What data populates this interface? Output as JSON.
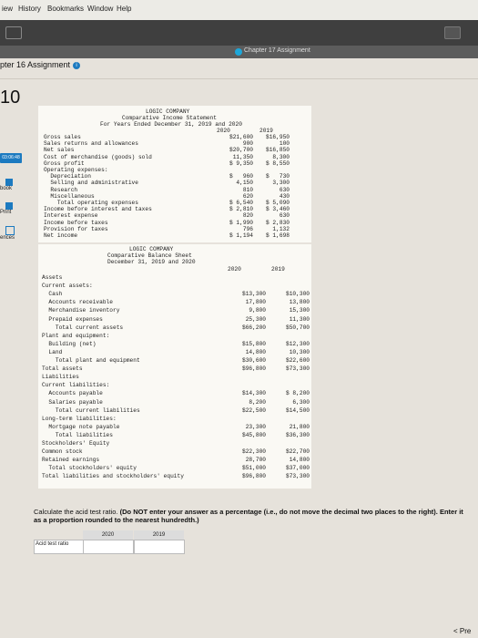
{
  "menu": [
    "iew",
    "History",
    "Bookmarks",
    "Window",
    "Help"
  ],
  "tab": {
    "title": "Chapter 17 Assignment"
  },
  "assignment": {
    "title": "pter 16 Assignment",
    "question_number": "10"
  },
  "sidebar": {
    "timer": "03:06:48",
    "items": [
      "book",
      "Print",
      "ences"
    ]
  },
  "income_statement": {
    "company": "LOGIC COMPANY",
    "title": "Comparative Income Statement",
    "period": "For Years Ended December 31, 2019 and 2020",
    "col1": "2020",
    "col2": "2019",
    "rows": [
      {
        "label": "Gross sales",
        "v1": "$21,600",
        "v2": "$16,950"
      },
      {
        "label": "Sales returns and allowances",
        "v1": "900",
        "v2": "100"
      },
      {
        "label": "Net sales",
        "v1": "$20,700",
        "v2": "$16,850"
      },
      {
        "label": "Cost of merchandise (goods) sold",
        "v1": "11,350",
        "v2": "8,300"
      },
      {
        "label": "Gross profit",
        "v1": "$ 9,350",
        "v2": "$ 8,550"
      },
      {
        "label": "Operating expenses:",
        "v1": "",
        "v2": ""
      },
      {
        "label": "  Depreciation",
        "v1": "$   960",
        "v2": "$   730"
      },
      {
        "label": "  Selling and administrative",
        "v1": "4,150",
        "v2": "3,300"
      },
      {
        "label": "  Research",
        "v1": "810",
        "v2": "630"
      },
      {
        "label": "  Miscellaneous",
        "v1": "620",
        "v2": "430"
      },
      {
        "label": "    Total operating expenses",
        "v1": "$ 6,540",
        "v2": "$ 5,090"
      },
      {
        "label": "Income before interest and taxes",
        "v1": "$ 2,810",
        "v2": "$ 3,460"
      },
      {
        "label": "Interest expense",
        "v1": "820",
        "v2": "630"
      },
      {
        "label": "Income before taxes",
        "v1": "$ 1,990",
        "v2": "$ 2,830"
      },
      {
        "label": "Provision for taxes",
        "v1": "796",
        "v2": "1,132"
      },
      {
        "label": "Net income",
        "v1": "$ 1,194",
        "v2": "$ 1,698"
      }
    ]
  },
  "balance_sheet": {
    "company": "LOGIC COMPANY",
    "title": "Comparative Balance Sheet",
    "period": "December 31, 2019 and 2020",
    "col1": "2020",
    "col2": "2019",
    "rows": [
      {
        "label": "Assets",
        "v1": "",
        "v2": ""
      },
      {
        "label": "Current assets:",
        "v1": "",
        "v2": ""
      },
      {
        "label": "  Cash",
        "v1": "$13,300",
        "v2": "$10,300"
      },
      {
        "label": "  Accounts receivable",
        "v1": "17,800",
        "v2": "13,800"
      },
      {
        "label": "  Merchandise inventory",
        "v1": "9,800",
        "v2": "15,300"
      },
      {
        "label": "  Prepaid expenses",
        "v1": "25,300",
        "v2": "11,300"
      },
      {
        "label": "    Total current assets",
        "v1": "$66,200",
        "v2": "$50,700"
      },
      {
        "label": "Plant and equipment:",
        "v1": "",
        "v2": ""
      },
      {
        "label": "  Building (net)",
        "v1": "$15,800",
        "v2": "$12,300"
      },
      {
        "label": "  Land",
        "v1": "14,800",
        "v2": "10,300"
      },
      {
        "label": "    Total plant and equipment",
        "v1": "$30,600",
        "v2": "$22,600"
      },
      {
        "label": "Total assets",
        "v1": "$96,800",
        "v2": "$73,300"
      },
      {
        "label": "Liabilities",
        "v1": "",
        "v2": ""
      },
      {
        "label": "Current liabilities:",
        "v1": "",
        "v2": ""
      },
      {
        "label": "  Accounts payable",
        "v1": "$14,300",
        "v2": "$ 8,200"
      },
      {
        "label": "  Salaries payable",
        "v1": "8,200",
        "v2": "6,300"
      },
      {
        "label": "    Total current liabilities",
        "v1": "$22,500",
        "v2": "$14,500"
      },
      {
        "label": "Long-term liabilities:",
        "v1": "",
        "v2": ""
      },
      {
        "label": "  Mortgage note payable",
        "v1": "23,300",
        "v2": "21,800"
      },
      {
        "label": "    Total liabilities",
        "v1": "$45,800",
        "v2": "$36,300"
      },
      {
        "label": "Stockholders' Equity",
        "v1": "",
        "v2": ""
      },
      {
        "label": "Common stock",
        "v1": "$22,300",
        "v2": "$22,700"
      },
      {
        "label": "Retained earnings",
        "v1": "28,700",
        "v2": "14,800"
      },
      {
        "label": "  Total stockholders' equity",
        "v1": "$51,000",
        "v2": "$37,000"
      },
      {
        "label": "Total liabilities and stockholders' equity",
        "v1": "$96,800",
        "v2": "$73,300"
      }
    ]
  },
  "question": {
    "text": "Calculate the acid test ratio. ",
    "bold": "(Do NOT enter your answer as a percentage (i.e., do not move the decimal two places to the right). Enter it as a proportion rounded to the nearest hundredth.)"
  },
  "answer_grid": {
    "col1": "2020",
    "col2": "2019",
    "row_label": "Acid test ratio",
    "val1": "",
    "val2": ""
  },
  "nav": {
    "prev": "< Pre"
  }
}
